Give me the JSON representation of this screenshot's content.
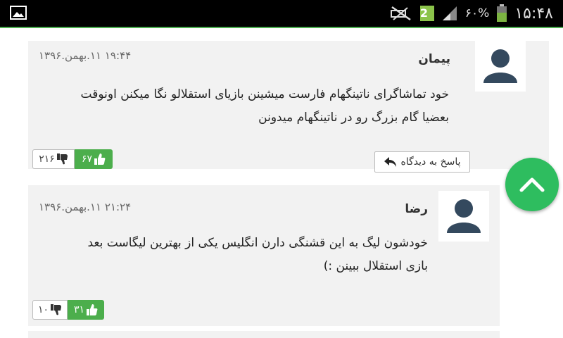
{
  "status_bar": {
    "time": "۱۵:۴۸",
    "battery_percent": "۶۰%",
    "notification_badge": "2",
    "icons": [
      "gallery-icon",
      "mute-icon",
      "notification-badge-icon",
      "signal-icon",
      "battery-icon"
    ]
  },
  "comments": [
    {
      "author": "پیمان",
      "date": "۱۹:۴۴ ۱۱.بهمن.۱۳۹۶",
      "text_lines": [
        "خود تماشاگرای ناتینگهام فارست میشینن بازیای استقلالو نگا میکنن اونوقت",
        "بعضیا گام بزرگ رو در ناتینگهام میدونن"
      ],
      "likes": "۶۷",
      "dislikes": "۲۱۶",
      "reply_label": "پاسخ به دیدگاه"
    },
    {
      "author": "رضا",
      "date": "۲۱:۲۴ ۱۱.بهمن.۱۳۹۶",
      "text_lines": [
        "خودشون لیگ به این قشنگی دارن انگلیس یکی از بهترین لیگاست بعد",
        "بازی استقلال ببینن :)"
      ],
      "likes": "۳۱",
      "dislikes": "۱۰"
    }
  ],
  "colors": {
    "accent": "#2ebd5f",
    "like_green": "#4cae4c",
    "avatar": "#34495e",
    "card_bg": "#f2f2f2"
  }
}
